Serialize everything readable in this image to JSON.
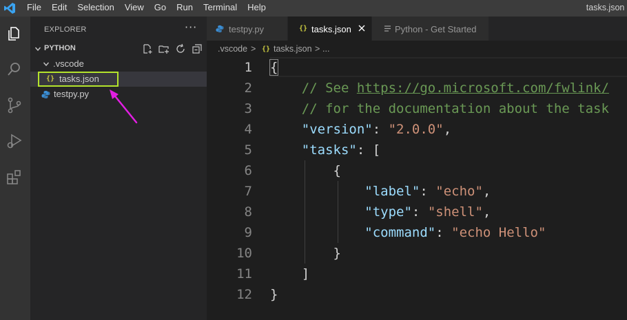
{
  "titlebar": {
    "menu": [
      "File",
      "Edit",
      "Selection",
      "View",
      "Go",
      "Run",
      "Terminal",
      "Help"
    ],
    "window_title": "tasks.json -"
  },
  "activity_bar": {
    "icons": [
      "files-icon",
      "search-icon",
      "source-control-icon",
      "run-debug-icon",
      "extensions-icon"
    ]
  },
  "sidebar": {
    "title": "EXPLORER",
    "more": "···",
    "folder": "PYTHON",
    "tree": [
      {
        "label": ".vscode",
        "type": "folder",
        "glyph": ""
      },
      {
        "label": "tasks.json",
        "type": "json",
        "glyph": "{}"
      },
      {
        "label": "testpy.py",
        "type": "python",
        "glyph": ""
      }
    ]
  },
  "tabs": [
    {
      "label": "testpy.py",
      "icon": "python-file-icon",
      "active": false
    },
    {
      "label": "tasks.json",
      "icon": "json-file-icon",
      "glyph": "{}",
      "active": true
    },
    {
      "label": "Python - Get Started",
      "icon": "preview-icon",
      "active": false
    }
  ],
  "breadcrumb": {
    "folder": ".vscode",
    "sep1": ">",
    "glyph": "{}",
    "file": "tasks.json",
    "sep2": ">",
    "tail": "..."
  },
  "editor": {
    "line_numbers": [
      "1",
      "2",
      "3",
      "4",
      "5",
      "6",
      "7",
      "8",
      "9",
      "10",
      "11",
      "12"
    ],
    "current_line": 1,
    "lines": [
      {
        "indent": "",
        "tokens": [
          [
            "punct",
            "{"
          ]
        ]
      },
      {
        "indent": "    ",
        "tokens": [
          [
            "comment",
            "// See "
          ],
          [
            "link",
            "https://go.microsoft.com/fwlink/"
          ]
        ]
      },
      {
        "indent": "    ",
        "tokens": [
          [
            "comment",
            "// for the documentation about the task"
          ]
        ]
      },
      {
        "indent": "    ",
        "tokens": [
          [
            "key",
            "\"version\""
          ],
          [
            "punct",
            ": "
          ],
          [
            "str",
            "\"2.0.0\""
          ],
          [
            "punct",
            ","
          ]
        ]
      },
      {
        "indent": "    ",
        "tokens": [
          [
            "key",
            "\"tasks\""
          ],
          [
            "punct",
            ": ["
          ]
        ]
      },
      {
        "indent": "        ",
        "tokens": [
          [
            "punct",
            "{"
          ]
        ]
      },
      {
        "indent": "            ",
        "tokens": [
          [
            "key",
            "\"label\""
          ],
          [
            "punct",
            ": "
          ],
          [
            "str",
            "\"echo\""
          ],
          [
            "punct",
            ","
          ]
        ]
      },
      {
        "indent": "            ",
        "tokens": [
          [
            "key",
            "\"type\""
          ],
          [
            "punct",
            ": "
          ],
          [
            "str",
            "\"shell\""
          ],
          [
            "punct",
            ","
          ]
        ]
      },
      {
        "indent": "            ",
        "tokens": [
          [
            "key",
            "\"command\""
          ],
          [
            "punct",
            ": "
          ],
          [
            "str",
            "\"echo Hello\""
          ]
        ]
      },
      {
        "indent": "        ",
        "tokens": [
          [
            "punct",
            "}"
          ]
        ]
      },
      {
        "indent": "    ",
        "tokens": [
          [
            "punct",
            "]"
          ]
        ]
      },
      {
        "indent": "",
        "tokens": [
          [
            "punct",
            "}"
          ]
        ]
      }
    ]
  },
  "colors": {
    "highlight_box": "#b4e32c",
    "annotation_arrow": "#e21ee2",
    "json_icon": "#cbcb41",
    "python_icon": "#3b8fd6"
  }
}
